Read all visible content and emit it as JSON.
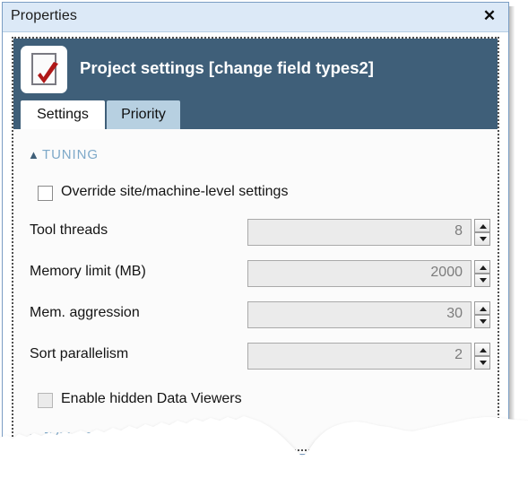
{
  "window": {
    "title": "Properties",
    "close_label": "✕",
    "close_icon": "close-icon"
  },
  "header": {
    "title": "Project settings [change field types2]",
    "icon": "checked-document-icon"
  },
  "tabs": [
    {
      "label": "Settings",
      "active": true
    },
    {
      "label": "Priority",
      "active": false
    }
  ],
  "sections": [
    {
      "id": "tuning",
      "label": "TUNING",
      "chevron": "▲",
      "chevron_icon": "chevron-up-icon",
      "expanded": true
    },
    {
      "id": "jvm",
      "label": "JVM SETTINGS",
      "chevron": "▼",
      "chevron_icon": "chevron-down-icon",
      "expanded": false
    }
  ],
  "checkboxes": [
    {
      "id": "override",
      "label": "Override site/machine-level settings",
      "checked": false,
      "disabled": false
    },
    {
      "id": "viewers",
      "label": "Enable hidden Data Viewers",
      "checked": false,
      "disabled": true
    }
  ],
  "fields": [
    {
      "label": "Tool threads",
      "value": "8"
    },
    {
      "label": "Memory limit (MB)",
      "value": "2000"
    },
    {
      "label": "Mem. aggression",
      "value": "30"
    },
    {
      "label": "Sort parallelism",
      "value": "2"
    }
  ],
  "colors": {
    "header_band": "#3f5f79",
    "titlebar": "#dce9f7",
    "tab_active": "#ffffff",
    "tab_inactive": "#b7d0e1",
    "section_label": "#7ea9c9",
    "field_bg": "#ebebeb",
    "check_mark": "#b01818"
  }
}
